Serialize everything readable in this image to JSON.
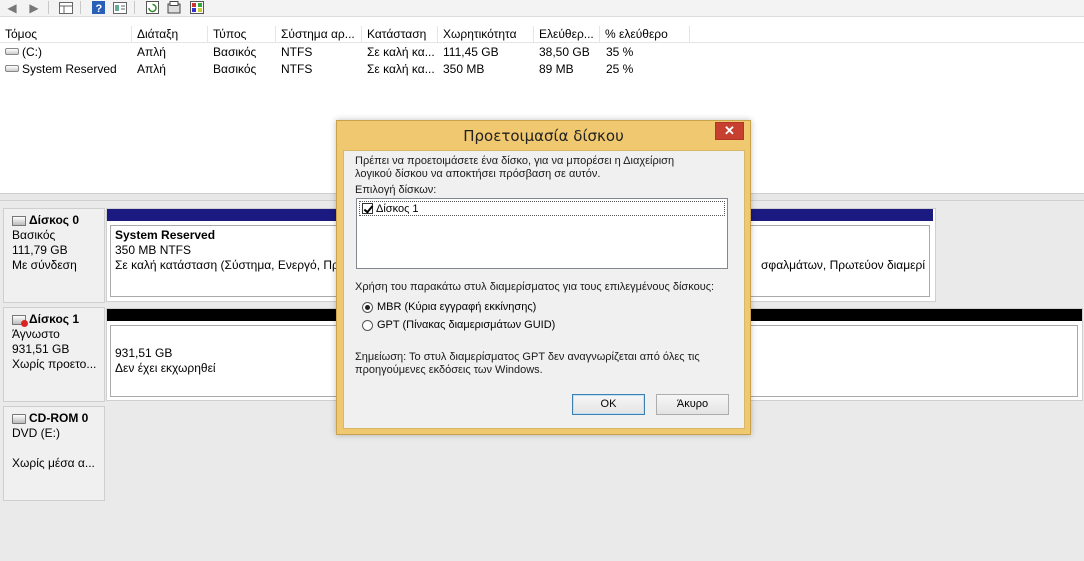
{
  "toolbar": {
    "icons": [
      "back-arrow-icon",
      "forward-arrow-icon",
      "view-icon",
      "help-icon",
      "view-list-icon",
      "refresh-icon",
      "properties-icon",
      "disk-settings-icon"
    ]
  },
  "volume_table": {
    "headers": [
      "Τόμος",
      "Διάταξη",
      "Τύπος",
      "Σύστημα αρ...",
      "Κατάσταση",
      "Χωρητικότητα",
      "Ελεύθερ...",
      "% ελεύθερο"
    ],
    "rows": [
      {
        "volume": "(C:)",
        "layout": "Απλή",
        "type": "Βασικός",
        "fs": "NTFS",
        "status": "Σε καλή κα...",
        "capacity": "111,45 GB",
        "free": "38,50 GB",
        "pct_free": "35 %"
      },
      {
        "volume": "System Reserved",
        "layout": "Απλή",
        "type": "Βασικός",
        "fs": "NTFS",
        "status": "Σε καλή κα...",
        "capacity": "350 MB",
        "free": "89 MB",
        "pct_free": "25 %"
      }
    ]
  },
  "disks": [
    {
      "name": "Δίσκος 0",
      "kind": "Βασικός",
      "size": "111,79 GB",
      "state": "Με σύνδεση",
      "partitions": [
        {
          "title": "System Reserved",
          "size_fs": "350 MB NTFS",
          "status": "Σε καλή κατάσταση (Σύστημα, Ενεργό, Πρ"
        },
        {
          "status_tail": "σφαλμάτων, Πρωτεύον διαμερί"
        }
      ]
    },
    {
      "name": "Δίσκος 1",
      "kind": "Άγνωστο",
      "size": "931,51 GB",
      "state": "Χωρίς προετο...",
      "partitions": [
        {
          "size": "931,51 GB",
          "status": "Δεν έχει εκχωρηθεί"
        }
      ]
    },
    {
      "name": "CD-ROM 0",
      "kind": "DVD (E:)",
      "size": "",
      "state": "Χωρίς μέσα α..."
    }
  ],
  "colors": {
    "primary_partition": "#1a1a80",
    "unallocated": "#000000",
    "dialog_frame": "#f0c86f",
    "close_button": "#c7402f"
  },
  "dialog": {
    "title": "Προετοιμασία δίσκου",
    "close_label": "✕",
    "intro_line1": "Πρέπει να προετοιμάσετε ένα δίσκο, για να μπορέσει η Διαχείριση",
    "intro_line2": "λογικού δίσκου να αποκτήσει πρόσβαση σε αυτόν.",
    "select_label": "Επιλογή δίσκων:",
    "disk_item": "Δίσκος 1",
    "disk_item_checked": true,
    "style_label": "Χρήση του παρακάτω στυλ διαμερίσματος για τους επιλεγμένους δίσκους:",
    "options": [
      {
        "label": "MBR (Κύρια εγγραφή εκκίνησης)",
        "selected": true
      },
      {
        "label": "GPT (Πίνακας διαμερισμάτων GUID)",
        "selected": false
      }
    ],
    "note_line1": "Σημείωση: Το στυλ διαμερίσματος GPT δεν αναγνωρίζεται από όλες τις",
    "note_line2": "προηγούμενες εκδόσεις των Windows.",
    "ok_label": "OK",
    "cancel_label": "Άκυρο"
  }
}
